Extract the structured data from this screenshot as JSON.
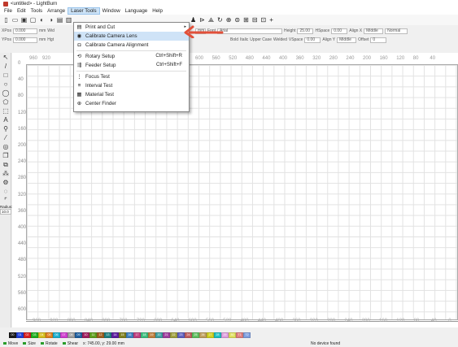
{
  "window": {
    "title": "<untitled> - LightBurn"
  },
  "menubar": {
    "items": [
      "File",
      "Edit",
      "Tools",
      "Arrange",
      "Laser Tools",
      "Window",
      "Language",
      "Help"
    ],
    "active_index": 4
  },
  "propbar": {
    "xpos_label": "XPos",
    "xpos_value": "0.000",
    "ypos_label": "YPos",
    "ypos_value": "0.000",
    "unit": "mm",
    "width_label": "Wid",
    "height_label": "Hgt",
    "unit_btn": "mm",
    "font_label": "Font",
    "font_value": "Arial",
    "bold": "Bold",
    "italic": "Italic",
    "upper": "Upper Case",
    "welded": "Welded",
    "height_label2": "Height",
    "height_value": "25.00",
    "hspace_label": "HSpace",
    "hspace_value": "0.00",
    "vspace_label": "VSpace",
    "vspace_value": "0.00",
    "alignx_label": "Align X",
    "alignx_value": "Middle",
    "aligny_label": "Align Y",
    "aligny_value": "Middle",
    "normal_value": "Normal",
    "offset_label": "Offset",
    "offset_value": "0"
  },
  "dropdown": {
    "items": [
      {
        "label": "Print and Cut",
        "icon": "printer-icon",
        "shortcut": "",
        "submenu": true,
        "highlight": false
      },
      {
        "label": "Calibrate Camera Lens",
        "icon": "camera-icon",
        "shortcut": "",
        "submenu": false,
        "highlight": true
      },
      {
        "label": "Calibrate Camera Alignment",
        "icon": "camera-align-icon",
        "shortcut": "",
        "submenu": false,
        "highlight": false
      },
      {
        "label": "Rotary Setup",
        "icon": "rotary-icon",
        "shortcut": "Ctrl+Shift+R",
        "submenu": false,
        "highlight": false
      },
      {
        "label": "Feeder Setup",
        "icon": "feeder-icon",
        "shortcut": "Ctrl+Shift+F",
        "submenu": false,
        "highlight": false
      },
      {
        "label": "Focus Test",
        "icon": "focus-icon",
        "shortcut": "",
        "submenu": false,
        "highlight": false
      },
      {
        "label": "Interval Test",
        "icon": "interval-icon",
        "shortcut": "",
        "submenu": false,
        "highlight": false
      },
      {
        "label": "Material Test",
        "icon": "grid-icon",
        "shortcut": "",
        "submenu": false,
        "highlight": false
      },
      {
        "label": "Center Finder",
        "icon": "crosshair-icon",
        "shortcut": "",
        "submenu": false,
        "highlight": false
      }
    ]
  },
  "leftrail": {
    "radius_label": "Radius:",
    "radius_value": "10.0"
  },
  "ruler": {
    "left_ticks": [
      "0",
      "40",
      "80",
      "120",
      "160",
      "200",
      "240",
      "280",
      "320",
      "360",
      "400",
      "440",
      "480",
      "520",
      "560",
      "600"
    ],
    "top_ticks": [
      "960",
      "920",
      "600",
      "560",
      "520",
      "480",
      "440",
      "400",
      "360",
      "320",
      "280",
      "240",
      "200",
      "160",
      "120",
      "80",
      "40"
    ],
    "bottom_ticks": [
      "960",
      "920",
      "880",
      "840",
      "800",
      "760",
      "720",
      "680",
      "640",
      "600",
      "560",
      "520",
      "480",
      "440",
      "400",
      "360",
      "320",
      "280",
      "240",
      "200",
      "160",
      "120",
      "80",
      "40",
      "0"
    ]
  },
  "palette": {
    "swatches": [
      {
        "label": "00",
        "color": "#1a1a1a"
      },
      {
        "label": "01",
        "color": "#2040d8"
      },
      {
        "label": "02",
        "color": "#d82020"
      },
      {
        "label": "03",
        "color": "#20b020"
      },
      {
        "label": "04",
        "color": "#d8c020"
      },
      {
        "label": "05",
        "color": "#e08020"
      },
      {
        "label": "06",
        "color": "#20b0d0"
      },
      {
        "label": "07",
        "color": "#d040d0"
      },
      {
        "label": "08",
        "color": "#a0a0a0"
      },
      {
        "label": "09",
        "color": "#2060a0"
      },
      {
        "label": "10",
        "color": "#a02060"
      },
      {
        "label": "11",
        "color": "#60a020"
      },
      {
        "label": "12",
        "color": "#a06020"
      },
      {
        "label": "13",
        "color": "#208080"
      },
      {
        "label": "14",
        "color": "#6020a0"
      },
      {
        "label": "15",
        "color": "#808020"
      },
      {
        "label": "16",
        "color": "#4080c0"
      },
      {
        "label": "17",
        "color": "#c04080"
      },
      {
        "label": "18",
        "color": "#40c080"
      },
      {
        "label": "19",
        "color": "#c08040"
      },
      {
        "label": "20",
        "color": "#40a0a0"
      },
      {
        "label": "21",
        "color": "#a040a0"
      },
      {
        "label": "22",
        "color": "#a0a040"
      },
      {
        "label": "23",
        "color": "#6060c0"
      },
      {
        "label": "24",
        "color": "#c06060"
      },
      {
        "label": "25",
        "color": "#60c060"
      },
      {
        "label": "26",
        "color": "#c0a060"
      },
      {
        "label": "27",
        "color": "#d0d020"
      },
      {
        "label": "28",
        "color": "#20c0c0"
      },
      {
        "label": "29",
        "color": "#e0a0e0"
      },
      {
        "label": "30",
        "color": "#e0e060"
      },
      {
        "label": "T1",
        "color": "#e08080"
      },
      {
        "label": "T2",
        "color": "#80a0e0"
      }
    ]
  },
  "status": {
    "move": "Move",
    "size": "Size",
    "rotate": "Rotate",
    "shear": "Shear",
    "coords": "x: 745.00, y: 29.00 mm",
    "device": "No device found"
  }
}
